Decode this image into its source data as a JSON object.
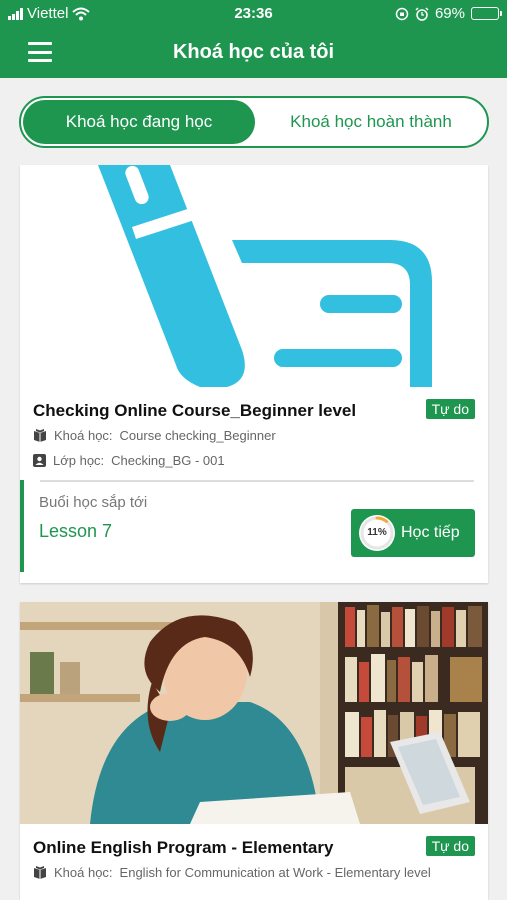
{
  "status_bar": {
    "carrier": "Viettel",
    "time": "23:36",
    "battery": "69%",
    "battery_level": 0.69
  },
  "header": {
    "title": "Khoá học của tôi"
  },
  "tabs": [
    {
      "label": "Khoá học đang học",
      "active": true
    },
    {
      "label": "Khoá học hoàn thành",
      "active": false
    }
  ],
  "courses": [
    {
      "title": "Checking Online Course_Beginner level",
      "badge": "Tự do",
      "course_label": "Khoá học:",
      "course_value": "Course checking_Beginner",
      "class_label": "Lớp học:",
      "class_value": "Checking_BG - 001",
      "upcoming_label": "Buổi học sắp tới",
      "upcoming_lesson": "Lesson 7",
      "progress_text": "11%",
      "progress": 0.11,
      "continue_label": "Học tiếp"
    },
    {
      "title": "Online English Program - Elementary",
      "badge": "Tự do",
      "course_label": "Khoá học:",
      "course_value": "English for Communication at Work - Elementary level"
    }
  ],
  "colors": {
    "primary": "#1e9650",
    "illustration": "#33bfe0"
  }
}
